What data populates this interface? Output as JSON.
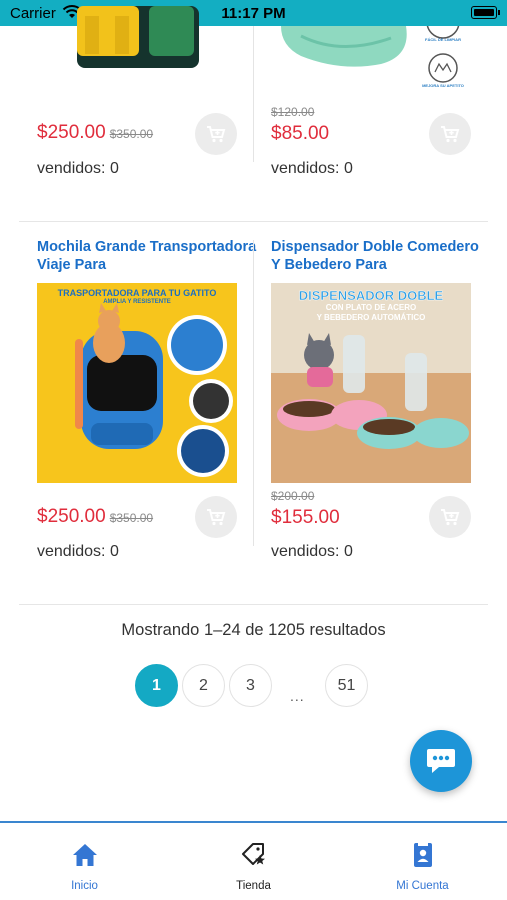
{
  "status_bar": {
    "carrier": "Carrier",
    "time": "11:17 PM"
  },
  "products": [
    {
      "title": "",
      "price": "$250.00",
      "old_price": "$350.00",
      "sold": "vendidos: 0",
      "image": "backpack-yellow-green"
    },
    {
      "title": "",
      "price": "$85.00",
      "old_price": "$120.00",
      "sold": "vendidos: 0",
      "image": "green-bowl",
      "image_badges": [
        "FÁCIL DE LIMPIAR",
        "MEJORA SU APETITO"
      ]
    },
    {
      "title": "Mochila Grande Transportadora Viaje Para",
      "price": "$250.00",
      "old_price": "$350.00",
      "sold": "vendidos: 0",
      "image": "cat-carrier-backpack",
      "image_text": {
        "headline": "TRASPORTADORA PARA TU GATITO",
        "sub": "AMPLIA Y RESISTENTE"
      }
    },
    {
      "title": "Dispensador Doble Comedero Y Bebedero Para",
      "price": "$155.00",
      "old_price": "$200.00",
      "sold": "vendidos: 0",
      "image": "double-feeder",
      "image_text": {
        "headline": "DISPENSADOR DOBLE",
        "line2": "CON PLATO DE ACERO",
        "line3": "Y BEBEDERO AUTOMÁTICO"
      }
    }
  ],
  "results_text": "Mostrando 1–24 de 1205 resultados",
  "pagination": {
    "pages": [
      "1",
      "2",
      "3",
      "51"
    ],
    "ellipsis": "...",
    "active": "1"
  },
  "tabbar": [
    {
      "label": "Inicio",
      "icon": "home-icon"
    },
    {
      "label": "Tienda",
      "icon": "tag-star-icon"
    },
    {
      "label": "Mi Cuenta",
      "icon": "account-book-icon"
    }
  ],
  "colors": {
    "accent": "#14a9c4",
    "price": "#e02d3c",
    "title": "#1a6ec8",
    "tab_active": "#3476d3",
    "fab": "#1d95d8"
  }
}
